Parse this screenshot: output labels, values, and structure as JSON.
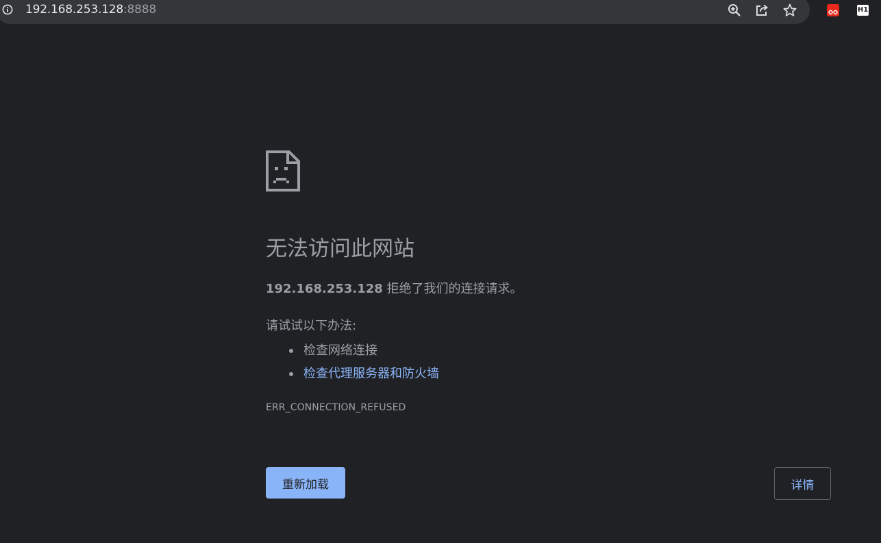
{
  "address_bar": {
    "host": "192.168.253.128",
    "port": ":8888",
    "info_icon": "info-icon"
  },
  "toolbar": {
    "icons": [
      "zoom-icon",
      "share-icon",
      "bookmark-star-icon"
    ],
    "extensions": {
      "red_extension_icon": "red-extension-icon",
      "h1_label": "H1"
    }
  },
  "error_page": {
    "icon": "sad-page-icon",
    "heading": "无法访问此网站",
    "description_host": "192.168.253.128",
    "description_rest": " 拒绝了我们的连接请求。",
    "try_label": "请试试以下办法:",
    "suggestions": [
      "检查网络连接",
      "检查代理服务器和防火墙"
    ],
    "error_code": "ERR_CONNECTION_REFUSED",
    "reload_label": "重新加载",
    "details_label": "详情"
  },
  "colors": {
    "background": "#202124",
    "text": "#9aa0a6",
    "link": "#8ab4f8",
    "primary_button": "#8ab4f8"
  }
}
